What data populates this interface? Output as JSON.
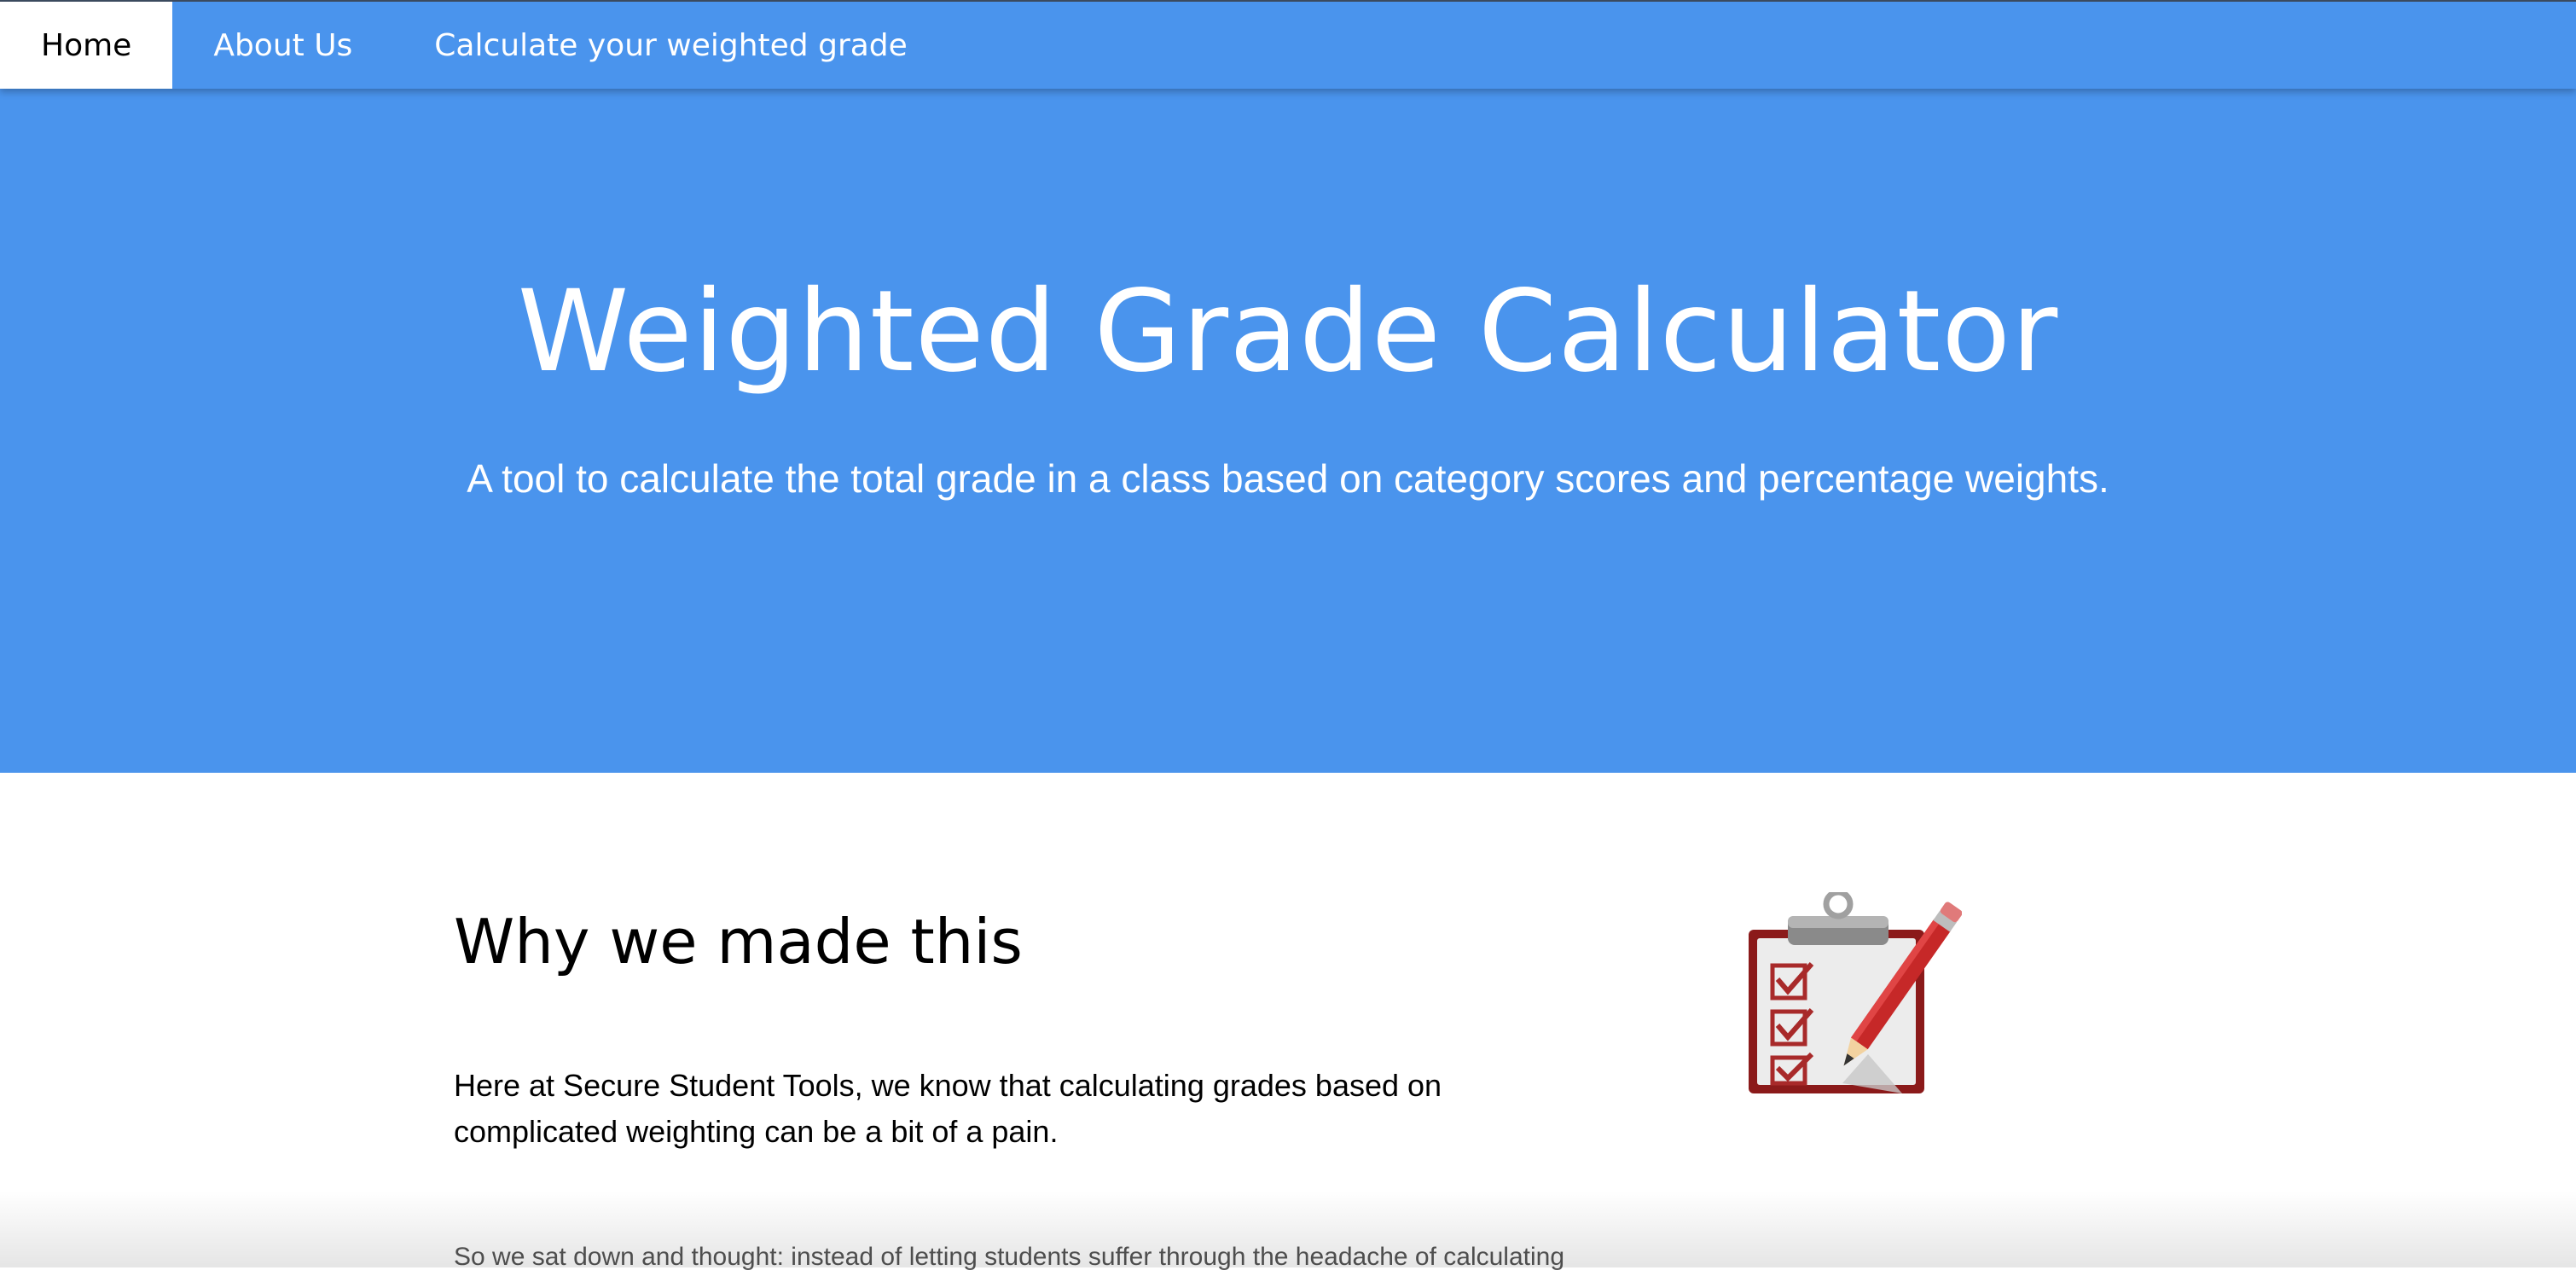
{
  "nav": {
    "items": [
      {
        "label": "Home",
        "active": true
      },
      {
        "label": "About Us",
        "active": false
      },
      {
        "label": "Calculate your weighted grade",
        "active": false
      }
    ]
  },
  "hero": {
    "title": "Weighted Grade Calculator",
    "subtitle": "A tool to calculate the total grade in a class based on category scores and percentage weights."
  },
  "about": {
    "heading": "Why we made this",
    "paragraph1": "Here at Secure Student Tools, we know that calculating grades based on complicated weighting can be a bit of a pain.",
    "paragraph2": "So we sat down and thought: instead of letting students suffer through the headache of calculating",
    "image_icon": "clipboard-checklist-pencil-icon"
  },
  "colors": {
    "accent": "#4a94ed",
    "nav_active_bg": "#ffffff",
    "text_primary": "#000000",
    "text_muted": "#555555"
  }
}
